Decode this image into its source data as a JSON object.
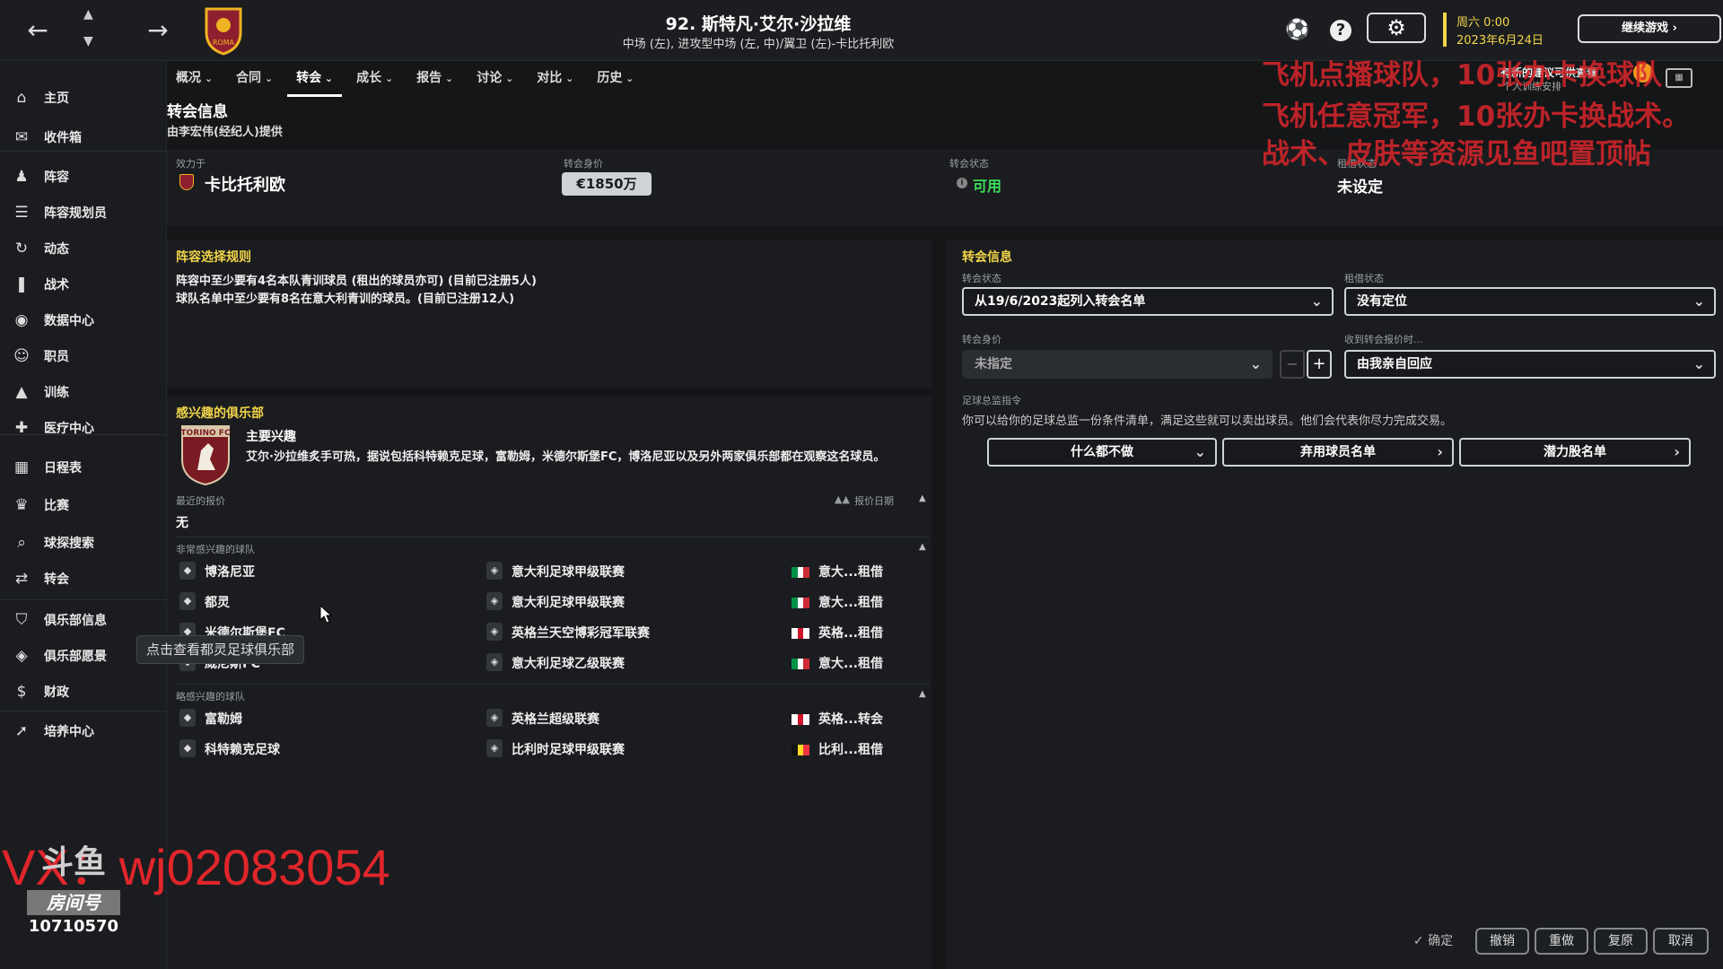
{
  "header": {
    "player_title": "92. 斯特凡·艾尔·沙拉维",
    "player_subtitle": "中场 (左), 进攻型中场 (左, 中)/翼卫 (左)-卡比托利欧",
    "crest_text": "ROMA",
    "date_day": "周六 0:00",
    "date": "2023年6月24日",
    "continue_label": "继续游戏"
  },
  "notification": {
    "title": "有新的建议可供查看",
    "subtitle": "个人训练安排"
  },
  "sidebar": {
    "items": [
      {
        "label": "主页",
        "icon": "home-icon"
      },
      {
        "label": "收件箱",
        "icon": "inbox-icon"
      },
      {
        "label": "阵容",
        "icon": "squad-icon"
      },
      {
        "label": "阵容规划员",
        "icon": "planner-icon"
      },
      {
        "label": "动态",
        "icon": "dynamics-icon"
      },
      {
        "label": "战术",
        "icon": "tactics-icon"
      },
      {
        "label": "数据中心",
        "icon": "data-icon"
      },
      {
        "label": "职员",
        "icon": "staff-icon"
      },
      {
        "label": "训练",
        "icon": "training-icon"
      },
      {
        "label": "医疗中心",
        "icon": "medical-icon"
      },
      {
        "label": "日程表",
        "icon": "calendar-icon"
      },
      {
        "label": "比赛",
        "icon": "trophy-icon"
      },
      {
        "label": "球探搜索",
        "icon": "search-icon"
      },
      {
        "label": "转会",
        "icon": "transfer-icon"
      },
      {
        "label": "俱乐部信息",
        "icon": "shield-icon"
      },
      {
        "label": "俱乐部愿景",
        "icon": "vision-icon"
      },
      {
        "label": "财政",
        "icon": "finance-icon"
      },
      {
        "label": "培养中心",
        "icon": "development-icon"
      }
    ]
  },
  "tabs": [
    "概况",
    "合同",
    "转会",
    "成长",
    "报告",
    "讨论",
    "对比",
    "历史"
  ],
  "page": {
    "title": "转会信息",
    "subtitle": "由李宏伟(经纪人)提供"
  },
  "summary": {
    "club_label": "效力于",
    "club_value": "卡比托利欧",
    "value_label": "转会身价",
    "value_value": "€1850万",
    "status_label": "转会状态",
    "status_value": "可用",
    "loan_label": "租借状态",
    "loan_value": "未设定"
  },
  "rules": {
    "title": "阵容选择规则",
    "line1": "阵容中至少要有4名本队青训球员 (租出的球员亦可) (目前已注册5人)",
    "line2": "球队名单中至少要有8名在意大利青训的球员。(目前已注册12人)"
  },
  "interest": {
    "title": "感兴趣的俱乐部",
    "main_label": "主要兴趣",
    "crest_text": "TORINO FC",
    "description": "艾尔·沙拉维炙手可热，据说包括科特赖克足球，富勒姆，米德尔斯堡FC，博洛尼亚以及另外两家俱乐部都在观察这名球员。",
    "recent_offers_label": "最近的报价",
    "offer_date_label": "报价日期",
    "recent_offers_value": "无",
    "very_interested_label": "非常感兴趣的球队",
    "very_interested": [
      {
        "club": "博洛尼亚",
        "league": "意大利足球甲级联赛",
        "nation": "意大...",
        "type": "租借",
        "flag": [
          "#009246",
          "#ffffff",
          "#ce2b37"
        ]
      },
      {
        "club": "都灵",
        "league": "意大利足球甲级联赛",
        "nation": "意大...",
        "type": "租借",
        "flag": [
          "#009246",
          "#ffffff",
          "#ce2b37"
        ]
      },
      {
        "club": "米德尔斯堡FC",
        "league": "英格兰天空博彩冠军联赛",
        "nation": "英格...",
        "type": "租借",
        "flag": [
          "#ffffff",
          "#cf142b",
          "#ffffff"
        ]
      },
      {
        "club": "威尼斯FC",
        "league": "意大利足球乙级联赛",
        "nation": "意大...",
        "type": "租借",
        "flag": [
          "#009246",
          "#ffffff",
          "#ce2b37"
        ]
      }
    ],
    "slightly_interested_label": "略感兴趣的球队",
    "slightly_interested": [
      {
        "club": "富勒姆",
        "league": "英格兰超级联赛",
        "nation": "英格...",
        "type": "转会",
        "flag": [
          "#ffffff",
          "#cf142b",
          "#ffffff"
        ]
      },
      {
        "club": "科特赖克足球",
        "league": "比利时足球甲级联赛",
        "nation": "比利...",
        "type": "租借",
        "flag": [
          "#111111",
          "#fdda24",
          "#ef3340"
        ]
      }
    ],
    "tooltip": "点击查看都灵足球俱乐部"
  },
  "transfer_panel": {
    "title": "转会信息",
    "status_label": "转会状态",
    "status_value": "从19/6/2023起列入转会名单",
    "loan_label": "租借状态",
    "loan_value": "没有定位",
    "value_label": "转会身价",
    "value_value": "未指定",
    "offer_label": "收到转会报价时...",
    "offer_value": "由我亲自回应",
    "director_label": "足球总监指令",
    "director_text": "你可以给你的足球总监一份条件清单，满足这些就可以卖出球员。他们会代表你尽力完成交易。",
    "btn_nothing": "什么都不做",
    "btn_unwanted": "弃用球员名单",
    "btn_potential": "潜力股名单"
  },
  "bottom_buttons": {
    "confirm": "确定",
    "undo": "撤销",
    "redo": "重做",
    "restore": "复原",
    "cancel": "取消"
  },
  "overlay": {
    "promo_line1": "飞机点播球队，10张办卡换球队",
    "promo_line2": "飞机任意冠军，10张办卡换战术。",
    "promo_line3": "战术、皮肤等资源见鱼吧置顶帖",
    "watermark": "VX：wj02083054",
    "room_label": "房间号",
    "room_number": "10710570",
    "logo_text": "斗鱼"
  },
  "colors": {
    "accent_yellow": "#f2d54a",
    "available_green": "#3adf5a",
    "promo_red": "#d8262b"
  }
}
